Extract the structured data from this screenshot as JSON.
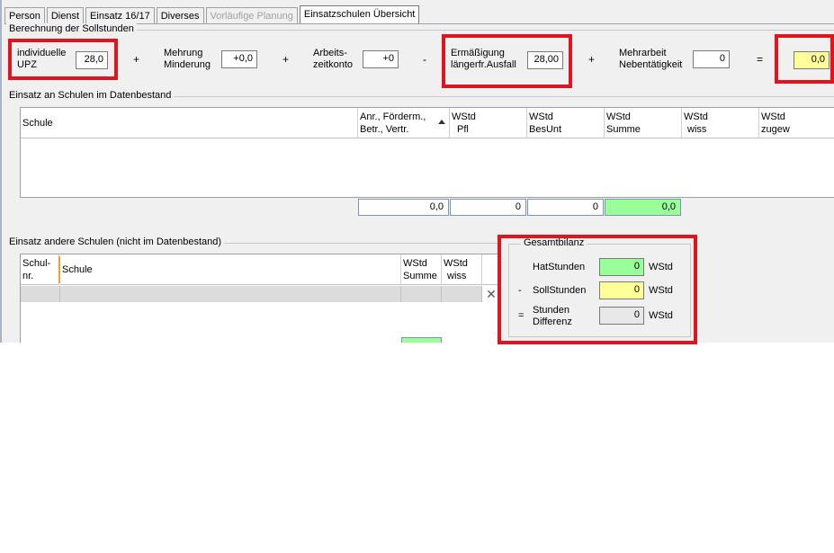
{
  "tabs": [
    {
      "label": "Person",
      "state": "normal"
    },
    {
      "label": "Dienst",
      "state": "normal"
    },
    {
      "label": "Einsatz 16/17",
      "state": "normal"
    },
    {
      "label": "Diverses",
      "state": "normal"
    },
    {
      "label": "Vorläufige Planung",
      "state": "disabled"
    },
    {
      "label": "Einsatzschulen Übersicht",
      "state": "active"
    }
  ],
  "soll": {
    "title": "Berechnung der Sollstunden",
    "upz_label_1": "individuelle",
    "upz_label_2": "UPZ",
    "upz_value": "28,0",
    "plus1": "+",
    "mehrung_label_1": "Mehrung",
    "mehrung_label_2": "Minderung",
    "mehrung_value": "+0,0",
    "plus2": "+",
    "arbeits_label_1": "Arbeits-",
    "arbeits_label_2": "zeitkonto",
    "arbeits_value": "+0",
    "minus": "-",
    "erm_label_1": "Ermäßigung",
    "erm_label_2": "längerfr.Ausfall",
    "erm_value": "28,00",
    "plus3": "+",
    "mehrarbeit_label_1": "Mehrarbeit",
    "mehrarbeit_label_2": "Nebentätigkeit",
    "mehrarbeit_value": "0",
    "equals": "=",
    "result_value": "0,0"
  },
  "einsatz": {
    "title": "Einsatz an Schulen im Datenbestand",
    "columns": [
      {
        "line1": "Schule",
        "line2": ""
      },
      {
        "line1": "Anr., Förderm.,",
        "line2": "Betr., Vertr."
      },
      {
        "line1": "WStd",
        "line2": "Pfl"
      },
      {
        "line1": "WStd",
        "line2": "BesUnt"
      },
      {
        "line1": "WStd",
        "line2": "Summe"
      },
      {
        "line1": "WStd",
        "line2": "wiss"
      },
      {
        "line1": "WStd",
        "line2": "zugew"
      }
    ],
    "sums": [
      "0,0",
      "0",
      "0",
      "0,0"
    ]
  },
  "andere": {
    "title": "Einsatz andere Schulen (nicht im Datenbestand)",
    "columns": [
      {
        "line1": "Schul-",
        "line2": "nr."
      },
      {
        "line1": "Schule",
        "line2": ""
      },
      {
        "line1": "WStd",
        "line2": "Summe"
      },
      {
        "line1": "WStd",
        "line2": "wiss"
      }
    ]
  },
  "bilanz": {
    "title": "Gesamtbilanz",
    "rows": [
      {
        "op": "",
        "label1": "HatStunden",
        "label2": "",
        "value": "0",
        "unit": "WStd",
        "color": "#99ff99"
      },
      {
        "op": "-",
        "label1": "SollStunden",
        "label2": "",
        "value": "0",
        "unit": "WStd",
        "color": "#ffff99"
      },
      {
        "op": "=",
        "label1": "Stunden",
        "label2": "Differenz",
        "value": "0",
        "unit": "WStd",
        "color": "#e8e8e8"
      }
    ]
  },
  "colors": {
    "highlight_red": "#e0141e",
    "green": "#99ff99",
    "yellow": "#ffff99"
  }
}
